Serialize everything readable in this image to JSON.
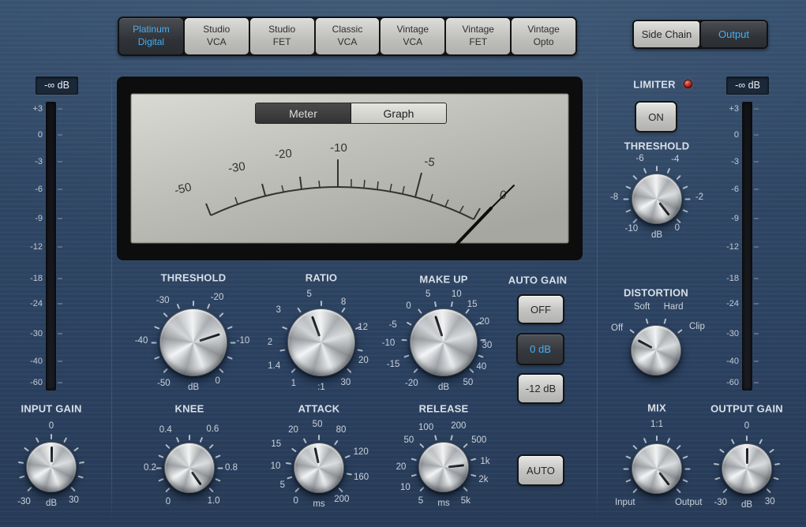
{
  "models": {
    "items": [
      {
        "label": "Platinum\nDigital",
        "selected": true
      },
      {
        "label": "Studio\nVCA",
        "selected": false
      },
      {
        "label": "Studio\nFET",
        "selected": false
      },
      {
        "label": "Classic\nVCA",
        "selected": false
      },
      {
        "label": "Vintage\nVCA",
        "selected": false
      },
      {
        "label": "Vintage\nFET",
        "selected": false
      },
      {
        "label": "Vintage\nOpto",
        "selected": false
      }
    ]
  },
  "view_toggle": {
    "side_chain": "Side Chain",
    "output": "Output"
  },
  "display": {
    "meter_tab": "Meter",
    "graph_tab": "Graph",
    "scale_labels": {
      "m50": "-50",
      "m30": "-30",
      "m20": "-20",
      "m10": "-10",
      "m5": "-5",
      "z": "0"
    }
  },
  "io_meters": {
    "value": "-∞ dB",
    "scale": [
      {
        "t": "+3",
        "f": 0.014
      },
      {
        "t": "0",
        "f": 0.108
      },
      {
        "t": "-3",
        "f": 0.205
      },
      {
        "t": "-6",
        "f": 0.304
      },
      {
        "t": "-9",
        "f": 0.409
      },
      {
        "t": "-12",
        "f": 0.511
      },
      {
        "t": "-18",
        "f": 0.625
      },
      {
        "t": "-24",
        "f": 0.716
      },
      {
        "t": "-30",
        "f": 0.824
      },
      {
        "t": "-40",
        "f": 0.923
      },
      {
        "t": "-60",
        "f": 1.0
      }
    ]
  },
  "limiter": {
    "title": "LIMITER",
    "on": "ON"
  },
  "auto_gain": {
    "title": "AUTO GAIN",
    "off": "OFF",
    "zero_db": "0 dB",
    "minus_12_db": "-12 dB"
  },
  "release_auto": "AUTO",
  "accent_colors": {
    "selected_text": "#45aef8",
    "led_red": "#c62c1f",
    "panel_blue": "#2f4765"
  },
  "knobs": {
    "input_gain": {
      "title": "INPUT GAIN",
      "unit": "dB",
      "pointer": 0,
      "ticks": [
        -135,
        -108,
        -81,
        -54,
        -27,
        0,
        27,
        54,
        81,
        108,
        135
      ],
      "marks": [
        [
          "0",
          0,
          52
        ],
        [
          "-30",
          -142,
          56
        ],
        [
          "30",
          146,
          51
        ]
      ]
    },
    "threshold": {
      "title": "THRESHOLD",
      "unit": "dB",
      "pointer": 72,
      "ticks": [
        -135,
        -112.5,
        -90,
        -67.5,
        -45,
        -22.5,
        0,
        22.5,
        45,
        67.5,
        90,
        112.5,
        135
      ],
      "marks": [
        [
          "-50",
          -144,
          64
        ],
        [
          "-40",
          -88,
          66
        ],
        [
          "-30",
          -36,
          66
        ],
        [
          "-20",
          28,
          64
        ],
        [
          "-10",
          88,
          63
        ],
        [
          "0",
          148,
          58
        ]
      ]
    },
    "ratio": {
      "title": "RATIO",
      "unit": ":1",
      "pointer": -20,
      "ticks": [
        -135,
        -101,
        -68,
        -34,
        0,
        34,
        68,
        101,
        135
      ],
      "marks": [
        [
          "1",
          -146,
          63
        ],
        [
          "1.4",
          -117,
          67
        ],
        [
          "2",
          -90,
          65
        ],
        [
          "3",
          -53,
          68
        ],
        [
          "5",
          -14,
          63
        ],
        [
          "8",
          29,
          58
        ],
        [
          "12",
          70,
          56
        ],
        [
          "20",
          113,
          58
        ],
        [
          "30",
          149,
          60
        ]
      ]
    },
    "make_up": {
      "title": "MAKE UP",
      "unit": "dB",
      "pointer": -18,
      "ticks": [
        -135,
        -110,
        -86,
        -61,
        -37,
        -12,
        12,
        37,
        61,
        86,
        110,
        135
      ],
      "marks": [
        [
          "-20",
          -142,
          66
        ],
        [
          "-15",
          -114,
          70
        ],
        [
          "-10",
          -91,
          70
        ],
        [
          "-5",
          -71,
          68
        ],
        [
          "0",
          -44,
          64
        ],
        [
          "5",
          -18,
          64
        ],
        [
          "10",
          15,
          63
        ],
        [
          "15",
          37,
          60
        ],
        [
          "20",
          63,
          58
        ],
        [
          "30",
          94,
          55
        ],
        [
          "40",
          123,
          57
        ],
        [
          "50",
          149,
          60
        ]
      ]
    },
    "knee": {
      "title": "KNEE",
      "unit": "",
      "pointer": 145,
      "ticks": [
        -135,
        -112.5,
        -90,
        -67.5,
        -45,
        -22.5,
        0,
        22.5,
        45,
        67.5,
        90,
        112.5,
        135
      ],
      "marks": [
        [
          "0",
          -148,
          51
        ],
        [
          "0.2",
          -90,
          50
        ],
        [
          "0.4",
          -32,
          57
        ],
        [
          "0.6",
          31,
          57
        ],
        [
          "0.8",
          90,
          53
        ],
        [
          "1.0",
          144,
          52
        ]
      ]
    },
    "attack": {
      "title": "ATTACK",
      "unit": "ms",
      "pointer": -12,
      "ticks": [
        -135,
        -108,
        -81,
        -54,
        -27,
        0,
        34,
        68,
        101,
        135
      ],
      "marks": [
        [
          "0",
          -145,
          51
        ],
        [
          "5",
          -115,
          51
        ],
        [
          "10",
          -88,
          55
        ],
        [
          "15",
          -61,
          62
        ],
        [
          "20",
          -34,
          58
        ],
        [
          "50",
          -2,
          55
        ],
        [
          "80",
          30,
          56
        ],
        [
          "120",
          69,
          57
        ],
        [
          "160",
          103,
          55
        ],
        [
          "200",
          144,
          49
        ]
      ]
    },
    "release": {
      "title": "RELEASE",
      "unit": "ms",
      "pointer": 84,
      "ticks": [
        -135,
        -105,
        -75,
        -45,
        -15,
        15,
        45,
        75,
        105,
        135
      ],
      "marks": [
        [
          "5",
          -146,
          52
        ],
        [
          "10",
          -118,
          55
        ],
        [
          "20",
          -90,
          54
        ],
        [
          "50",
          -52,
          56
        ],
        [
          "100",
          -24,
          55
        ],
        [
          "200",
          20,
          55
        ],
        [
          "500",
          53,
          56
        ],
        [
          "1k",
          82,
          53
        ],
        [
          "2k",
          108,
          53
        ],
        [
          "5k",
          147,
          51
        ]
      ]
    },
    "limiter_threshold": {
      "title": "THRESHOLD",
      "unit": "dB",
      "pointer": 142,
      "ticks": [
        -135,
        -112.5,
        -90,
        -67.5,
        -45,
        -22.5,
        0,
        22.5,
        45,
        67.5,
        90,
        112.5,
        135
      ],
      "marks": [
        [
          "-10",
          -140,
          50
        ],
        [
          "-8",
          -88,
          54
        ],
        [
          "-6",
          -23,
          55
        ],
        [
          "-4",
          25,
          55
        ],
        [
          "-2",
          88,
          54
        ],
        [
          "0",
          145,
          45
        ]
      ]
    },
    "distortion": {
      "title": "DISTORTION",
      "unit": "",
      "pointer": -62,
      "ticks": [
        -51,
        -17,
        17,
        51
      ],
      "marks": [
        [
          "Off",
          -60,
          57
        ],
        [
          "Soft",
          -18,
          58
        ],
        [
          "Hard",
          22,
          59
        ],
        [
          "Clip",
          60,
          60
        ]
      ]
    },
    "mix": {
      "title": "MIX",
      "unit": "",
      "pointer": 142,
      "ticks": [
        -135,
        -112.5,
        -90,
        -67.5,
        -45,
        -22.5,
        0,
        22.5,
        45,
        67.5,
        90,
        112.5,
        135
      ],
      "marks": [
        [
          "1:1",
          0,
          56
        ],
        [
          "Input",
          -137,
          59
        ],
        [
          "Output",
          137,
          59
        ]
      ]
    },
    "output_gain": {
      "title": "OUTPUT GAIN",
      "unit": "dB",
      "pointer": 0,
      "ticks": [
        -135,
        -108,
        -81,
        -54,
        -27,
        0,
        27,
        54,
        81,
        108,
        135
      ],
      "marks": [
        [
          "0",
          0,
          54
        ],
        [
          "-30",
          -142,
          54
        ],
        [
          "30",
          145,
          51
        ]
      ]
    }
  }
}
